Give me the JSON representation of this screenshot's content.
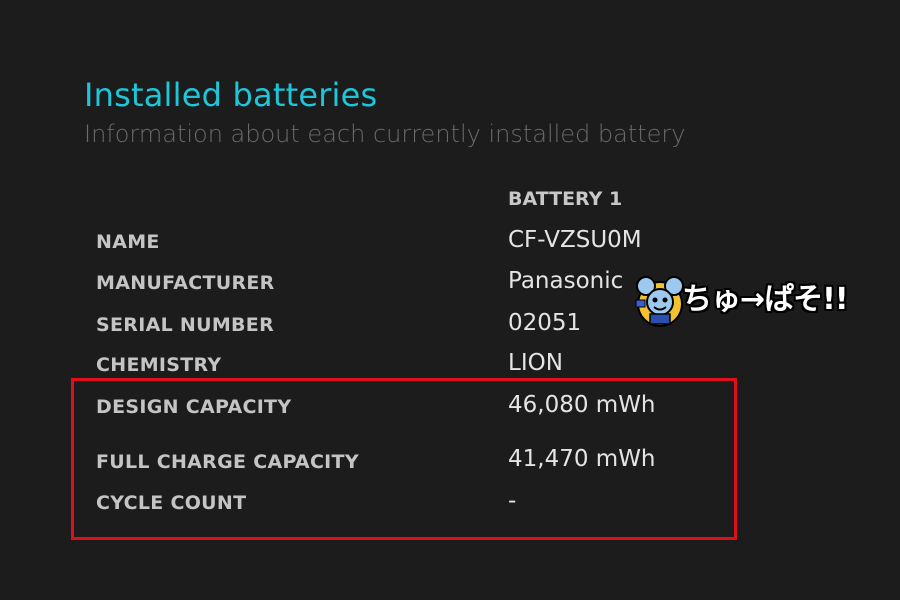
{
  "header": {
    "title": "Installed batteries",
    "subtitle": "Information about each currently installed battery"
  },
  "table": {
    "column_header": "BATTERY 1",
    "rows": [
      {
        "label": "NAME",
        "value": "CF-VZSU0M"
      },
      {
        "label": "MANUFACTURER",
        "value": "Panasonic"
      },
      {
        "label": "SERIAL NUMBER",
        "value": "02051"
      },
      {
        "label": "CHEMISTRY",
        "value": "LION"
      },
      {
        "label": "DESIGN CAPACITY",
        "value": "46,080 mWh"
      },
      {
        "label": "FULL CHARGE CAPACITY",
        "value": "41,470 mWh"
      },
      {
        "label": "CYCLE COUNT",
        "value": "-"
      }
    ]
  },
  "overlay": {
    "sticker_text": "ちゅ→ぱそ!!",
    "highlight_color": "#e0101a"
  },
  "colors": {
    "background": "#1c1c1c",
    "title_accent": "#1ec6d9",
    "subtitle": "#6a6a6a",
    "label": "#c4c4c4",
    "value": "#e4e4e4"
  }
}
